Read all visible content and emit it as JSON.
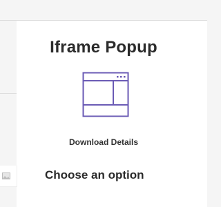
{
  "popup": {
    "title": "Iframe Popup",
    "icon": "browser-window-icon",
    "download_label": "Download Details",
    "options_heading": "Choose an option"
  },
  "side_panel": {
    "thumbnail_icon": "image-placeholder-icon"
  },
  "colors": {
    "accent": "#6b5bb5",
    "title_text": "#2b2b2b",
    "background": "#f5f5f5"
  }
}
